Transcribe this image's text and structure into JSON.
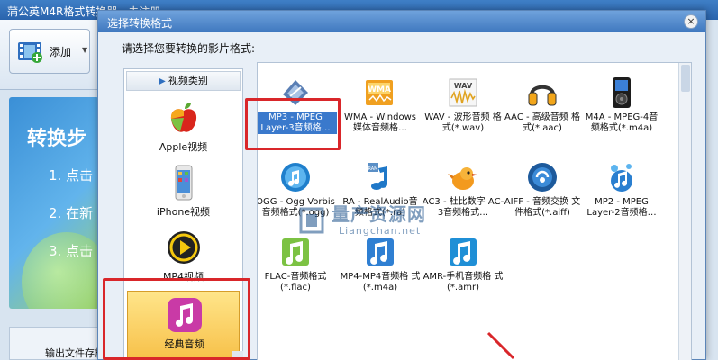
{
  "background_app": {
    "title": "蒲公英M4R格式转换器 - 未注册",
    "toolbar": {
      "add_label": "添加"
    },
    "steps": {
      "title": "转换步",
      "items": [
        "1. 点击",
        "2. 在新",
        "3. 点击"
      ]
    },
    "output_label": "输出文件存放"
  },
  "dialog": {
    "title": "选择转换格式",
    "close_glyph": "×",
    "prompt": "请选择您要转换的影片格式:",
    "category_header": "视频类别",
    "categories": [
      {
        "label": "Apple视频"
      },
      {
        "label": "iPhone视频"
      },
      {
        "label": "MP4视频"
      },
      {
        "label": "经典音频"
      }
    ],
    "formats": [
      {
        "label": "MP3 - MPEG Layer-3音频格…",
        "selected": true
      },
      {
        "label": "WMA - Windows 媒体音频格…",
        "icon_text": "WMA"
      },
      {
        "label": "WAV - 波形音频 格式(*.wav)",
        "icon_text": "WAV"
      },
      {
        "label": "AAC - 高级音频 格式(*.aac)"
      },
      {
        "label": "M4A - MPEG-4音 频格式(*.m4a)"
      },
      {
        "label": "OGG - Ogg Vorbis 音频格式(*.ogg)"
      },
      {
        "label": "RA - RealAudio音 频格式(*.ra)",
        "icon_text": "RAM"
      },
      {
        "label": "AC3 - 杜比数字 AC-3音频格式…"
      },
      {
        "label": "AIFF - 音频交换 文件格式(*.aiff)"
      },
      {
        "label": "MP2 - MPEG Layer-2音频格…"
      },
      {
        "label": "FLAC-音频格式 (*.flac)"
      },
      {
        "label": "MP4-MP4音频格 式(*.m4a)"
      },
      {
        "label": "AMR-手机音频格 式(*.amr)"
      }
    ]
  },
  "watermark": {
    "main": "量产资源网",
    "sub": "Liangchan.net"
  },
  "colors": {
    "highlight": "#d9262a",
    "selection": "#3a79cc",
    "category_selected": "#f7c14a",
    "title_bar": "#3f78bf"
  }
}
